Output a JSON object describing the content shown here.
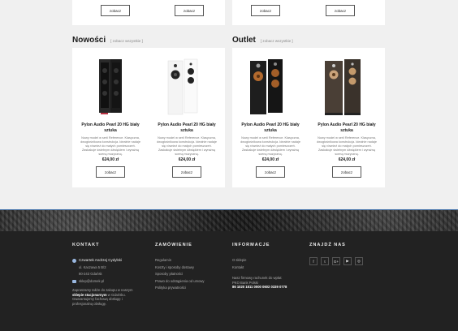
{
  "top_buttons": [
    "zobacz",
    "zobacz",
    "zobacz",
    "zobacz"
  ],
  "sections": [
    {
      "title": "Nowości",
      "link": "[ zobacz wszystkie ]",
      "products": [
        {
          "name": "Pylon Audio Pearl 20 HG biały sztuka",
          "desc": "Nowy model w serii Reference. Klasyczna, dwugłośnikowa konstrukcja. Idealnie nadaje się również do małych pomieszczeń. Zaskakuje świetnym dźwiękiem i wyraźną sceną muzyczną.",
          "price": "624,00 zł",
          "button": "zobacz",
          "color": "black"
        },
        {
          "name": "Pylon Audio Pearl 20 HG biały sztuka",
          "desc": "Nowy model w serii Reference. Klasyczna, dwugłośnikowa konstrukcja. Idealnie nadaje się również do małych pomieszczeń. Zaskakuje świetnym dźwiękiem i wyraźną sceną muzyczną.",
          "price": "624,00 zł",
          "button": "zobacz",
          "color": "white"
        }
      ]
    },
    {
      "title": "Outlet",
      "link": "[ zobacz wszystkie ]",
      "products": [
        {
          "name": "Pylon Audio Pearl 20 HG biały sztuka",
          "desc": "Nowy model w serii Reference. Klasyczna, dwugłośnikowa konstrukcja. Idealnie nadaje się również do małych pomieszczeń. Zaskakuje świetnym dźwiękiem i wyraźną sceną muzyczną.",
          "price": "624,00 zł",
          "button": "zobacz",
          "color": "black-copper"
        },
        {
          "name": "Pylon Audio Pearl 20 HG biały sztuka",
          "desc": "Nowy model w serii Reference. Klasyczna, dwugłośnikowa konstrukcja. Idealnie nadaje się również do małych pomieszczeń. Zaskakuje świetnym dźwiękiem i wyraźną sceną muzyczną.",
          "price": "624,00 zł",
          "button": "zobacz",
          "color": "dark-wood"
        }
      ]
    }
  ],
  "footer": {
    "kontakt": {
      "heading": "KONTAKT",
      "name": "Czwartek Andrzej Cydylski",
      "street": "ul. Kaczawa 5 B/2",
      "city": "80-243 Gdańsk",
      "email": "sklep@domek.pl",
      "note_before": "Zapraszamy także do zakupu w naszym",
      "note_bold": "sklepie stacjonarnym",
      "note_after": "w Gdańsku. Gwarantujemy fachową obsługę i profesjonalną obsługę."
    },
    "zamowienie": {
      "heading": "ZAMÓWIENIE",
      "items": [
        "Regulamin",
        "Koszty i sposoby dostawy",
        "Sposoby płatności",
        "Prawo do odstąpienia od umowy",
        "Polityka prywatności"
      ]
    },
    "informacje": {
      "heading": "INFORMACJE",
      "items": [
        "O sklepie",
        "Kontakt"
      ],
      "account_label": "Nasz firmowy rachunek do wpłat:",
      "bank": "PKO Bank Polski",
      "account": "86 1020 1811 0000 0602 0339 0778"
    },
    "social": {
      "heading": "ZNAJDŹ NAS",
      "icons": [
        {
          "name": "facebook-icon",
          "glyph": "f"
        },
        {
          "name": "twitter-icon",
          "glyph": "t"
        },
        {
          "name": "google-plus-icon",
          "glyph": "G+"
        },
        {
          "name": "youtube-icon",
          "glyph": "▶"
        },
        {
          "name": "instagram-icon",
          "glyph": "◎"
        }
      ]
    }
  }
}
